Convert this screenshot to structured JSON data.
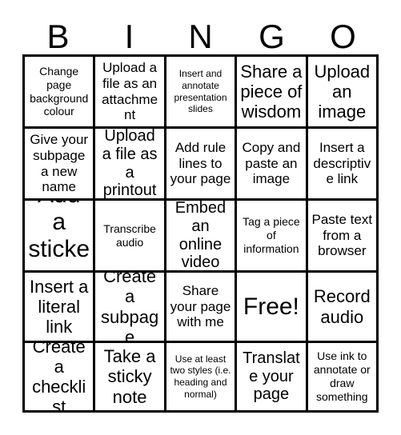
{
  "card": {
    "title": "BINGO",
    "header_letters": [
      "B",
      "I",
      "N",
      "G",
      "O"
    ],
    "columns": 5,
    "rows": 5,
    "free_space_label": "Free!",
    "free_space_position": {
      "row": 4,
      "column": 3
    },
    "border_color": "#000000",
    "background_color": "#ffffff",
    "text_color": "#000000"
  },
  "cells": [
    {
      "row": 1,
      "col": 1,
      "column_letter": "B",
      "text": "Change page background colour",
      "size": "sm"
    },
    {
      "row": 1,
      "col": 2,
      "column_letter": "I",
      "text": "Upload a file as an attachment",
      "size": "md"
    },
    {
      "row": 1,
      "col": 3,
      "column_letter": "N",
      "text": "Insert and annotate presentation slides",
      "size": "xs"
    },
    {
      "row": 1,
      "col": 4,
      "column_letter": "G",
      "text": "Share a piece of wisdom",
      "size": "xl"
    },
    {
      "row": 1,
      "col": 5,
      "column_letter": "O",
      "text": "Upload an image",
      "size": "xl"
    },
    {
      "row": 2,
      "col": 1,
      "column_letter": "B",
      "text": "Give your subpage a new name",
      "size": "md"
    },
    {
      "row": 2,
      "col": 2,
      "column_letter": "I",
      "text": "Upload a file as a printout",
      "size": "lg"
    },
    {
      "row": 2,
      "col": 3,
      "column_letter": "N",
      "text": "Add rule lines to your page",
      "size": "md"
    },
    {
      "row": 2,
      "col": 4,
      "column_letter": "G",
      "text": "Copy and paste an image",
      "size": "md"
    },
    {
      "row": 2,
      "col": 5,
      "column_letter": "O",
      "text": "Insert a descriptive link",
      "size": "md"
    },
    {
      "row": 3,
      "col": 1,
      "column_letter": "B",
      "text": "Add a sticker",
      "size": "xxl"
    },
    {
      "row": 3,
      "col": 2,
      "column_letter": "I",
      "text": "Transcribe audio",
      "size": "sm"
    },
    {
      "row": 3,
      "col": 3,
      "column_letter": "N",
      "text": "Embed an online video",
      "size": "lg"
    },
    {
      "row": 3,
      "col": 4,
      "column_letter": "G",
      "text": "Tag a piece of information",
      "size": "sm"
    },
    {
      "row": 3,
      "col": 5,
      "column_letter": "O",
      "text": "Paste text from a browser",
      "size": "md"
    },
    {
      "row": 4,
      "col": 1,
      "column_letter": "B",
      "text": "Insert a literal link",
      "size": "xl"
    },
    {
      "row": 4,
      "col": 2,
      "column_letter": "I",
      "text": "Create a subpage",
      "size": "xl"
    },
    {
      "row": 4,
      "col": 3,
      "column_letter": "N",
      "text": "Share your page with me",
      "size": "md"
    },
    {
      "row": 4,
      "col": 4,
      "column_letter": "G",
      "text": "Free!",
      "size": "xxl"
    },
    {
      "row": 4,
      "col": 5,
      "column_letter": "O",
      "text": "Record audio",
      "size": "xl"
    },
    {
      "row": 5,
      "col": 1,
      "column_letter": "B",
      "text": "Create a checklist",
      "size": "xl"
    },
    {
      "row": 5,
      "col": 2,
      "column_letter": "I",
      "text": "Take a sticky note",
      "size": "xl"
    },
    {
      "row": 5,
      "col": 3,
      "column_letter": "N",
      "text": "Use at least two styles (i.e. heading and normal)",
      "size": "xs"
    },
    {
      "row": 5,
      "col": 4,
      "column_letter": "G",
      "text": "Translate your page",
      "size": "lg"
    },
    {
      "row": 5,
      "col": 5,
      "column_letter": "O",
      "text": "Use ink to annotate or draw something",
      "size": "sm"
    }
  ]
}
